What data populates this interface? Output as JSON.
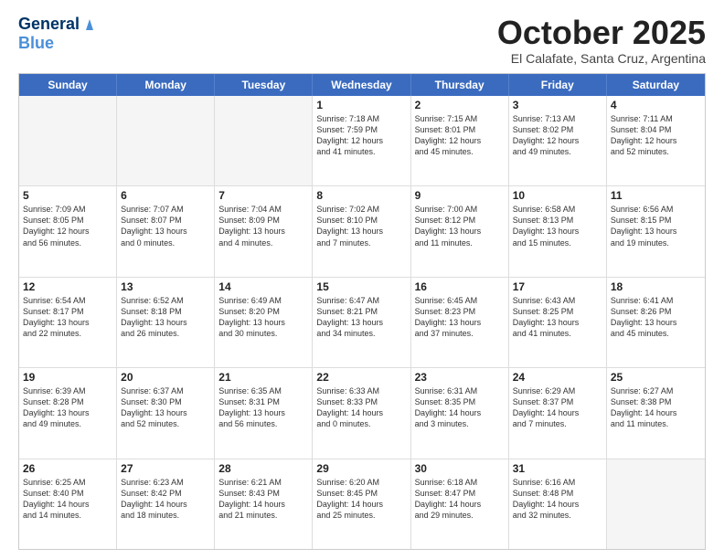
{
  "logo": {
    "general": "General",
    "blue": "Blue"
  },
  "header": {
    "month": "October 2025",
    "location": "El Calafate, Santa Cruz, Argentina"
  },
  "weekdays": [
    "Sunday",
    "Monday",
    "Tuesday",
    "Wednesday",
    "Thursday",
    "Friday",
    "Saturday"
  ],
  "rows": [
    [
      {
        "day": "",
        "info": "",
        "empty": true
      },
      {
        "day": "",
        "info": "",
        "empty": true
      },
      {
        "day": "",
        "info": "",
        "empty": true
      },
      {
        "day": "1",
        "info": "Sunrise: 7:18 AM\nSunset: 7:59 PM\nDaylight: 12 hours\nand 41 minutes.",
        "empty": false
      },
      {
        "day": "2",
        "info": "Sunrise: 7:15 AM\nSunset: 8:01 PM\nDaylight: 12 hours\nand 45 minutes.",
        "empty": false
      },
      {
        "day": "3",
        "info": "Sunrise: 7:13 AM\nSunset: 8:02 PM\nDaylight: 12 hours\nand 49 minutes.",
        "empty": false
      },
      {
        "day": "4",
        "info": "Sunrise: 7:11 AM\nSunset: 8:04 PM\nDaylight: 12 hours\nand 52 minutes.",
        "empty": false
      }
    ],
    [
      {
        "day": "5",
        "info": "Sunrise: 7:09 AM\nSunset: 8:05 PM\nDaylight: 12 hours\nand 56 minutes.",
        "empty": false
      },
      {
        "day": "6",
        "info": "Sunrise: 7:07 AM\nSunset: 8:07 PM\nDaylight: 13 hours\nand 0 minutes.",
        "empty": false
      },
      {
        "day": "7",
        "info": "Sunrise: 7:04 AM\nSunset: 8:09 PM\nDaylight: 13 hours\nand 4 minutes.",
        "empty": false
      },
      {
        "day": "8",
        "info": "Sunrise: 7:02 AM\nSunset: 8:10 PM\nDaylight: 13 hours\nand 7 minutes.",
        "empty": false
      },
      {
        "day": "9",
        "info": "Sunrise: 7:00 AM\nSunset: 8:12 PM\nDaylight: 13 hours\nand 11 minutes.",
        "empty": false
      },
      {
        "day": "10",
        "info": "Sunrise: 6:58 AM\nSunset: 8:13 PM\nDaylight: 13 hours\nand 15 minutes.",
        "empty": false
      },
      {
        "day": "11",
        "info": "Sunrise: 6:56 AM\nSunset: 8:15 PM\nDaylight: 13 hours\nand 19 minutes.",
        "empty": false
      }
    ],
    [
      {
        "day": "12",
        "info": "Sunrise: 6:54 AM\nSunset: 8:17 PM\nDaylight: 13 hours\nand 22 minutes.",
        "empty": false
      },
      {
        "day": "13",
        "info": "Sunrise: 6:52 AM\nSunset: 8:18 PM\nDaylight: 13 hours\nand 26 minutes.",
        "empty": false
      },
      {
        "day": "14",
        "info": "Sunrise: 6:49 AM\nSunset: 8:20 PM\nDaylight: 13 hours\nand 30 minutes.",
        "empty": false
      },
      {
        "day": "15",
        "info": "Sunrise: 6:47 AM\nSunset: 8:21 PM\nDaylight: 13 hours\nand 34 minutes.",
        "empty": false
      },
      {
        "day": "16",
        "info": "Sunrise: 6:45 AM\nSunset: 8:23 PM\nDaylight: 13 hours\nand 37 minutes.",
        "empty": false
      },
      {
        "day": "17",
        "info": "Sunrise: 6:43 AM\nSunset: 8:25 PM\nDaylight: 13 hours\nand 41 minutes.",
        "empty": false
      },
      {
        "day": "18",
        "info": "Sunrise: 6:41 AM\nSunset: 8:26 PM\nDaylight: 13 hours\nand 45 minutes.",
        "empty": false
      }
    ],
    [
      {
        "day": "19",
        "info": "Sunrise: 6:39 AM\nSunset: 8:28 PM\nDaylight: 13 hours\nand 49 minutes.",
        "empty": false
      },
      {
        "day": "20",
        "info": "Sunrise: 6:37 AM\nSunset: 8:30 PM\nDaylight: 13 hours\nand 52 minutes.",
        "empty": false
      },
      {
        "day": "21",
        "info": "Sunrise: 6:35 AM\nSunset: 8:31 PM\nDaylight: 13 hours\nand 56 minutes.",
        "empty": false
      },
      {
        "day": "22",
        "info": "Sunrise: 6:33 AM\nSunset: 8:33 PM\nDaylight: 14 hours\nand 0 minutes.",
        "empty": false
      },
      {
        "day": "23",
        "info": "Sunrise: 6:31 AM\nSunset: 8:35 PM\nDaylight: 14 hours\nand 3 minutes.",
        "empty": false
      },
      {
        "day": "24",
        "info": "Sunrise: 6:29 AM\nSunset: 8:37 PM\nDaylight: 14 hours\nand 7 minutes.",
        "empty": false
      },
      {
        "day": "25",
        "info": "Sunrise: 6:27 AM\nSunset: 8:38 PM\nDaylight: 14 hours\nand 11 minutes.",
        "empty": false
      }
    ],
    [
      {
        "day": "26",
        "info": "Sunrise: 6:25 AM\nSunset: 8:40 PM\nDaylight: 14 hours\nand 14 minutes.",
        "empty": false
      },
      {
        "day": "27",
        "info": "Sunrise: 6:23 AM\nSunset: 8:42 PM\nDaylight: 14 hours\nand 18 minutes.",
        "empty": false
      },
      {
        "day": "28",
        "info": "Sunrise: 6:21 AM\nSunset: 8:43 PM\nDaylight: 14 hours\nand 21 minutes.",
        "empty": false
      },
      {
        "day": "29",
        "info": "Sunrise: 6:20 AM\nSunset: 8:45 PM\nDaylight: 14 hours\nand 25 minutes.",
        "empty": false
      },
      {
        "day": "30",
        "info": "Sunrise: 6:18 AM\nSunset: 8:47 PM\nDaylight: 14 hours\nand 29 minutes.",
        "empty": false
      },
      {
        "day": "31",
        "info": "Sunrise: 6:16 AM\nSunset: 8:48 PM\nDaylight: 14 hours\nand 32 minutes.",
        "empty": false
      },
      {
        "day": "",
        "info": "",
        "empty": true
      }
    ]
  ]
}
